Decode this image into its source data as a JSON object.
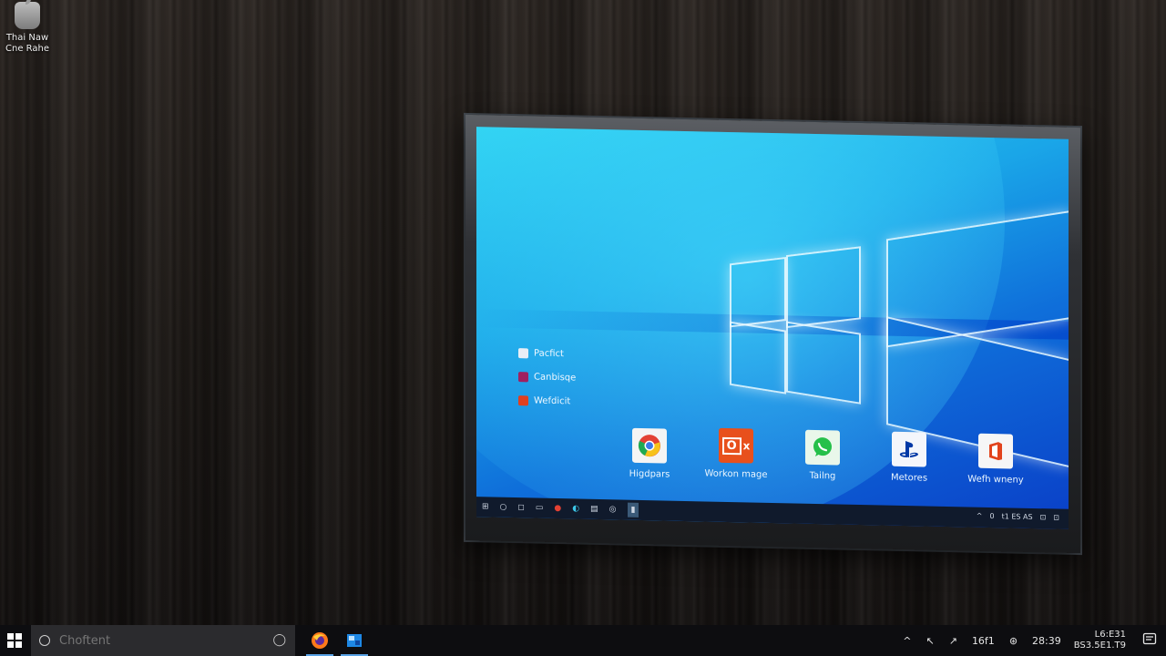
{
  "desktop": {
    "icon_label": "Thai Naw\nCne Rahe"
  },
  "monitor_screen": {
    "side_list": [
      {
        "label": "Pacfict",
        "color": "#e8eef6"
      },
      {
        "label": "Canbisqe",
        "color": "#a02060"
      },
      {
        "label": "Wefdicit",
        "color": "#e04020"
      }
    ],
    "app_tiles": [
      {
        "label": "Higdpars",
        "icon": "chrome-icon",
        "bg": "#f4f4f4",
        "fg": "#e34133"
      },
      {
        "label": "Workon mage",
        "icon": "office-icon",
        "bg": "#e8501c",
        "fg": "#ffffff"
      },
      {
        "label": "Tailng",
        "icon": "whatsapp-icon",
        "bg": "#e9f7ea",
        "fg": "#25c04a"
      },
      {
        "label": "Metores",
        "icon": "playstation-icon",
        "bg": "#f4f6fb",
        "fg": "#0039a6"
      },
      {
        "label": "Wefh wneny",
        "icon": "office-icon",
        "bg": "#f6f6f6",
        "fg": "#e2431c"
      }
    ],
    "taskbar_tray": [
      "^",
      "0",
      "t1 ES AS",
      "⊡",
      "⊡"
    ]
  },
  "taskbar": {
    "search_placeholder": "Choftent",
    "tray_items": [
      "^",
      "↖",
      "↗",
      "16f1",
      "⊛",
      "28:39"
    ],
    "clock_line1": "L6:E31",
    "clock_line2": "BS3.5E1.T9"
  }
}
